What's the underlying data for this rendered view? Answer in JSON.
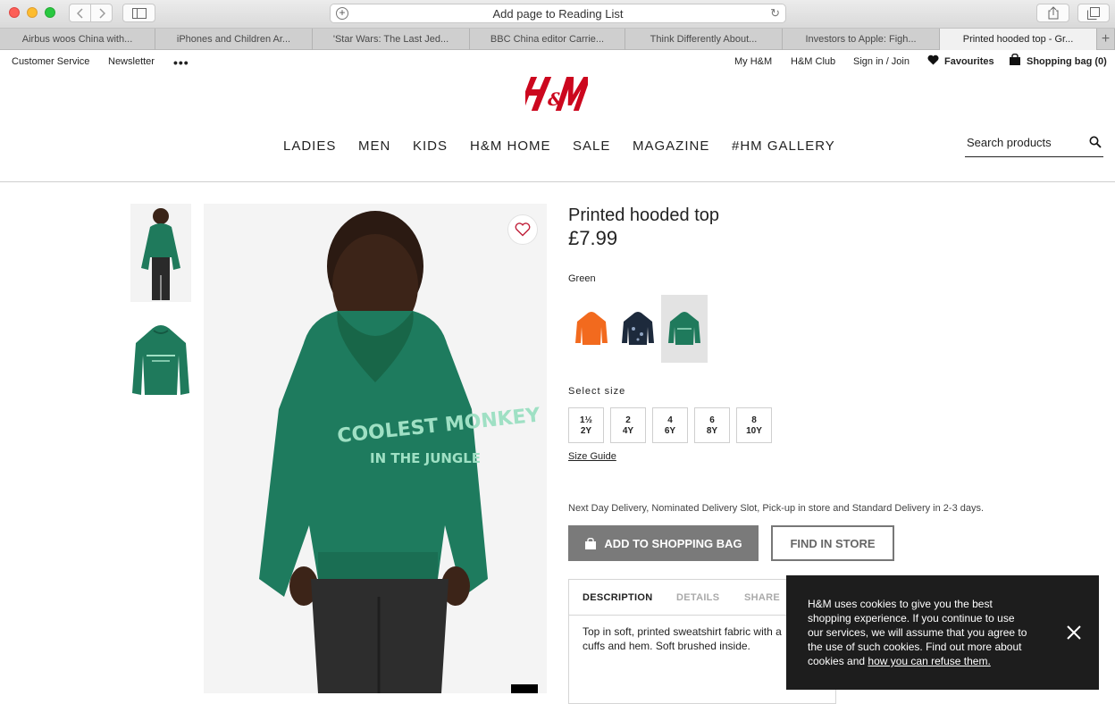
{
  "browser": {
    "url_placeholder": "Add page to Reading List",
    "tabs": [
      {
        "label": "Airbus woos China with..."
      },
      {
        "label": "iPhones and Children Ar..."
      },
      {
        "label": "'Star Wars: The Last Jed..."
      },
      {
        "label": "BBC China editor Carrie..."
      },
      {
        "label": "Think Differently About..."
      },
      {
        "label": "Investors to Apple: Figh..."
      },
      {
        "label": "Printed hooded top - Gr..."
      }
    ],
    "new_tab": "+"
  },
  "utility": {
    "customer_service": "Customer Service",
    "newsletter": "Newsletter",
    "more": "•••",
    "my_hm": "My H&M",
    "hm_club": "H&M Club",
    "sign_in": "Sign in / Join",
    "favourites": "Favourites",
    "shopping_bag": "Shopping bag (0)"
  },
  "brand": {
    "color": "#cc071e"
  },
  "nav": {
    "items": [
      "LADIES",
      "MEN",
      "KIDS",
      "H&M HOME",
      "SALE",
      "MAGAZINE",
      "#HM GALLERY"
    ]
  },
  "search": {
    "placeholder": "Search products"
  },
  "product": {
    "title": "Printed hooded top",
    "price": "£7.99",
    "color": "Green",
    "hoodie_print_line1": "COOLEST MONKEY",
    "hoodie_print_line2": "IN THE JUNGLE",
    "select_size_label": "Select size",
    "sizes": [
      {
        "top": "1½",
        "bottom": "2Y"
      },
      {
        "top": "2",
        "bottom": "4Y"
      },
      {
        "top": "4",
        "bottom": "6Y"
      },
      {
        "top": "6",
        "bottom": "8Y"
      },
      {
        "top": "8",
        "bottom": "10Y"
      }
    ],
    "size_guide": "Size Guide",
    "delivery": "Next Day Delivery, Nominated Delivery Slot, Pick-up in store and Standard Delivery in 2-3 days.",
    "add_to_bag": "ADD TO SHOPPING BAG",
    "find_in_store": "FIND IN STORE",
    "desc_tabs": [
      "DESCRIPTION",
      "DETAILS",
      "SHARE"
    ],
    "description": "Top in soft, printed sweatshirt fabric with a cuffs and hem. Soft brushed inside."
  },
  "cookie": {
    "text": "H&M uses cookies to give you the best shopping experience. If you continue to use our services, we will assume that you agree to the use of such cookies. Find out more about cookies and ",
    "link": "how you can refuse them."
  }
}
